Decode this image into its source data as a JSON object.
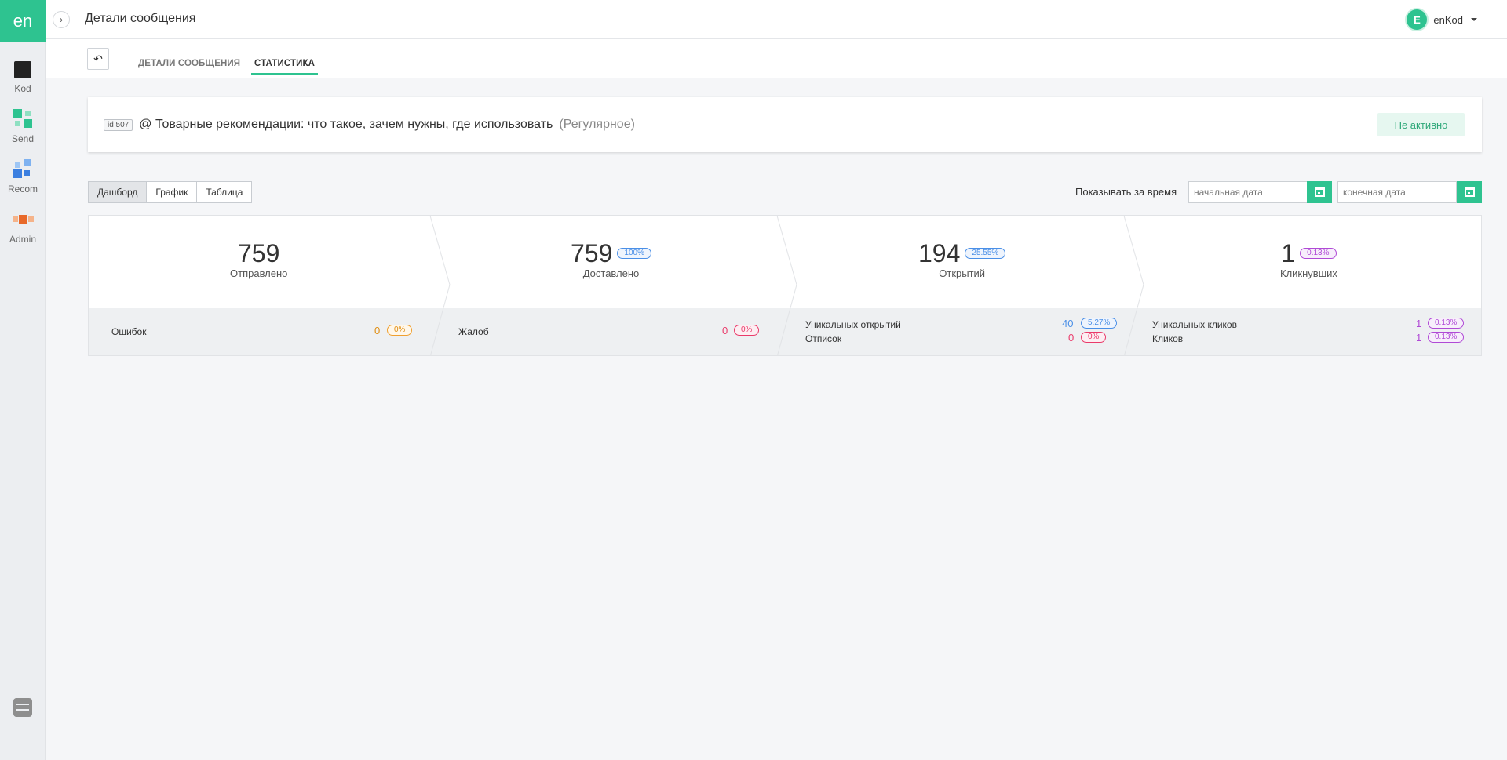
{
  "rail": {
    "logo": "en",
    "items": [
      {
        "label": "Kod"
      },
      {
        "label": "Send"
      },
      {
        "label": "Recom"
      },
      {
        "label": "Admin"
      }
    ]
  },
  "header": {
    "title": "Детали сообщения",
    "avatar_letter": "E",
    "user_name": "enKod"
  },
  "tabs": [
    {
      "label": "Детали сообщения"
    },
    {
      "label": "Статистика"
    }
  ],
  "message": {
    "id": "id 507",
    "title": "@ Товарные рекомендации: что такое, зачем нужны, где использовать",
    "type": "(Регулярное)",
    "status": "Не активно"
  },
  "views": [
    "Дашборд",
    "График",
    "Таблица"
  ],
  "period": {
    "label": "Показывать за время",
    "start_placeholder": "начальная дата",
    "end_placeholder": "конечная дата"
  },
  "stats": {
    "sent": {
      "value": "759",
      "label": "Отправлено"
    },
    "delivered": {
      "value": "759",
      "pct": "100%",
      "label": "Доставлено"
    },
    "opened": {
      "value": "194",
      "pct": "25.55%",
      "label": "Открытий"
    },
    "clicked": {
      "value": "1",
      "pct": "0.13%",
      "label": "Кликнувших"
    }
  },
  "details": {
    "errors": {
      "label": "Ошибок",
      "value": "0",
      "pct": "0%"
    },
    "complaints": {
      "label": "Жалоб",
      "value": "0",
      "pct": "0%"
    },
    "unique_opens": {
      "label": "Уникальных открытий",
      "value": "40",
      "pct": "5.27%"
    },
    "unsubscribes": {
      "label": "Отписок",
      "value": "0",
      "pct": "0%"
    },
    "unique_clicks": {
      "label": "Уникальных кликов",
      "value": "1",
      "pct": "0.13%"
    },
    "clicks": {
      "label": "Кликов",
      "value": "1",
      "pct": "0.13%"
    }
  },
  "colors": {
    "accent": "#2ec390",
    "blue": "#4a8fe7",
    "purple": "#b04ad6",
    "orange": "#f0a030",
    "pink": "#ea3a6a"
  }
}
